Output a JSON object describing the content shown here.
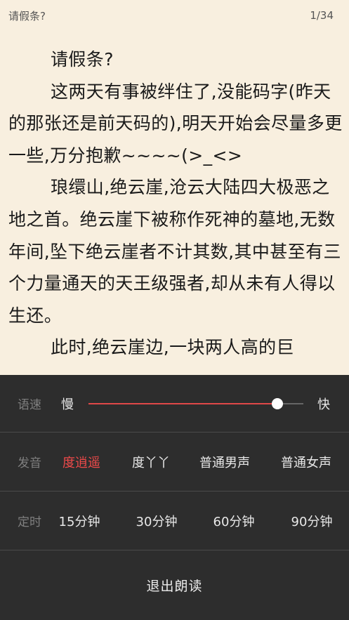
{
  "header": {
    "title": "请假条?",
    "page_indicator": "1/34"
  },
  "content": {
    "paragraphs": [
      "请假条?",
      "这两天有事被绊住了,没能码字(昨天的那张还是前天码的),明天开始会尽量多更一些,万分抱歉~~~~(>_<>",
      "琅缳山,绝云崖,沧云大陆四大极恶之地之首。绝云崖下被称作死神的墓地,无数年间,坠下绝云崖者不计其数,其中甚至有三个力量通天的天王级强者,却从未有人得以生还。",
      "此时,绝云崖边,一块两人高的巨"
    ]
  },
  "panel": {
    "speed": {
      "label": "语速",
      "slow_label": "慢",
      "fast_label": "快",
      "value": 0.88
    },
    "voice": {
      "label": "发音",
      "options": [
        "度逍遥",
        "度丫丫",
        "普通男声",
        "普通女声"
      ],
      "selected": "度逍遥"
    },
    "timer": {
      "label": "定时",
      "options": [
        "15分钟",
        "30分钟",
        "60分钟",
        "90分钟"
      ]
    },
    "exit_label": "退出朗读"
  },
  "colors": {
    "page_background": "#f8efdf",
    "panel_background": "#2d2d2d",
    "accent": "#ef4a4a"
  }
}
